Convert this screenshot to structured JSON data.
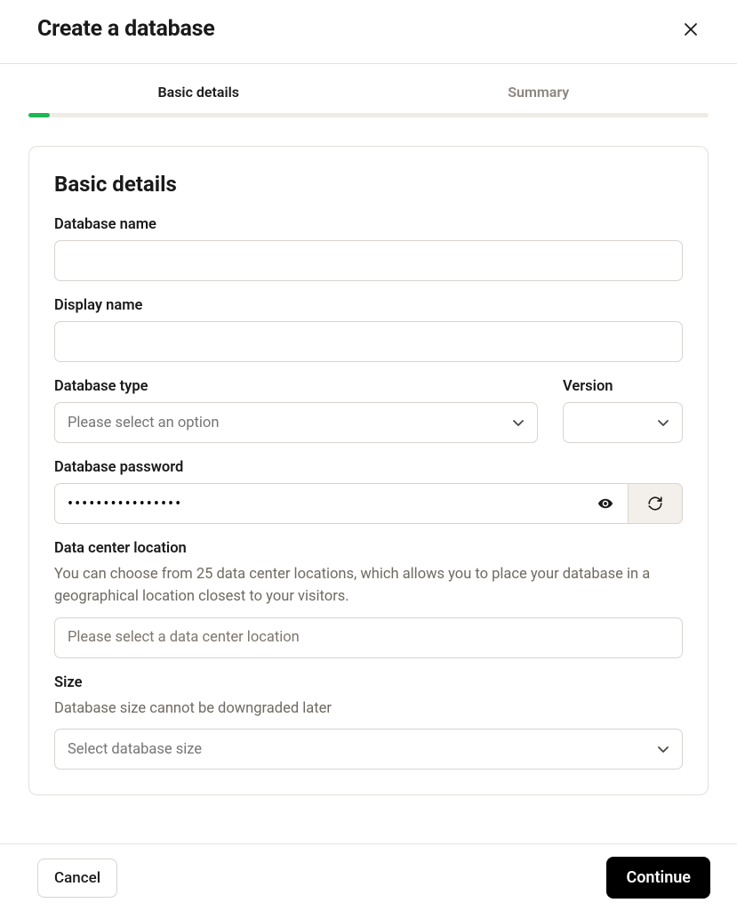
{
  "header": {
    "title": "Create a database"
  },
  "tabs": {
    "items": [
      {
        "label": "Basic details"
      },
      {
        "label": "Summary"
      }
    ]
  },
  "card": {
    "title": "Basic details",
    "fields": {
      "database_name": {
        "label": "Database name",
        "value": ""
      },
      "display_name": {
        "label": "Display name",
        "value": ""
      },
      "database_type": {
        "label": "Database type",
        "placeholder": "Please select an option"
      },
      "version": {
        "label": "Version",
        "placeholder": ""
      },
      "database_password": {
        "label": "Database password",
        "value": "••••••••••••••••"
      },
      "data_center": {
        "label": "Data center location",
        "help": "You can choose from 25 data center locations, which allows you to place your database in a geographical location closest to your visitors.",
        "placeholder": "Please select a data center location"
      },
      "size": {
        "label": "Size",
        "help": "Database size cannot be downgraded later",
        "placeholder": "Select database size"
      }
    }
  },
  "footer": {
    "cancel": "Cancel",
    "continue": "Continue"
  }
}
